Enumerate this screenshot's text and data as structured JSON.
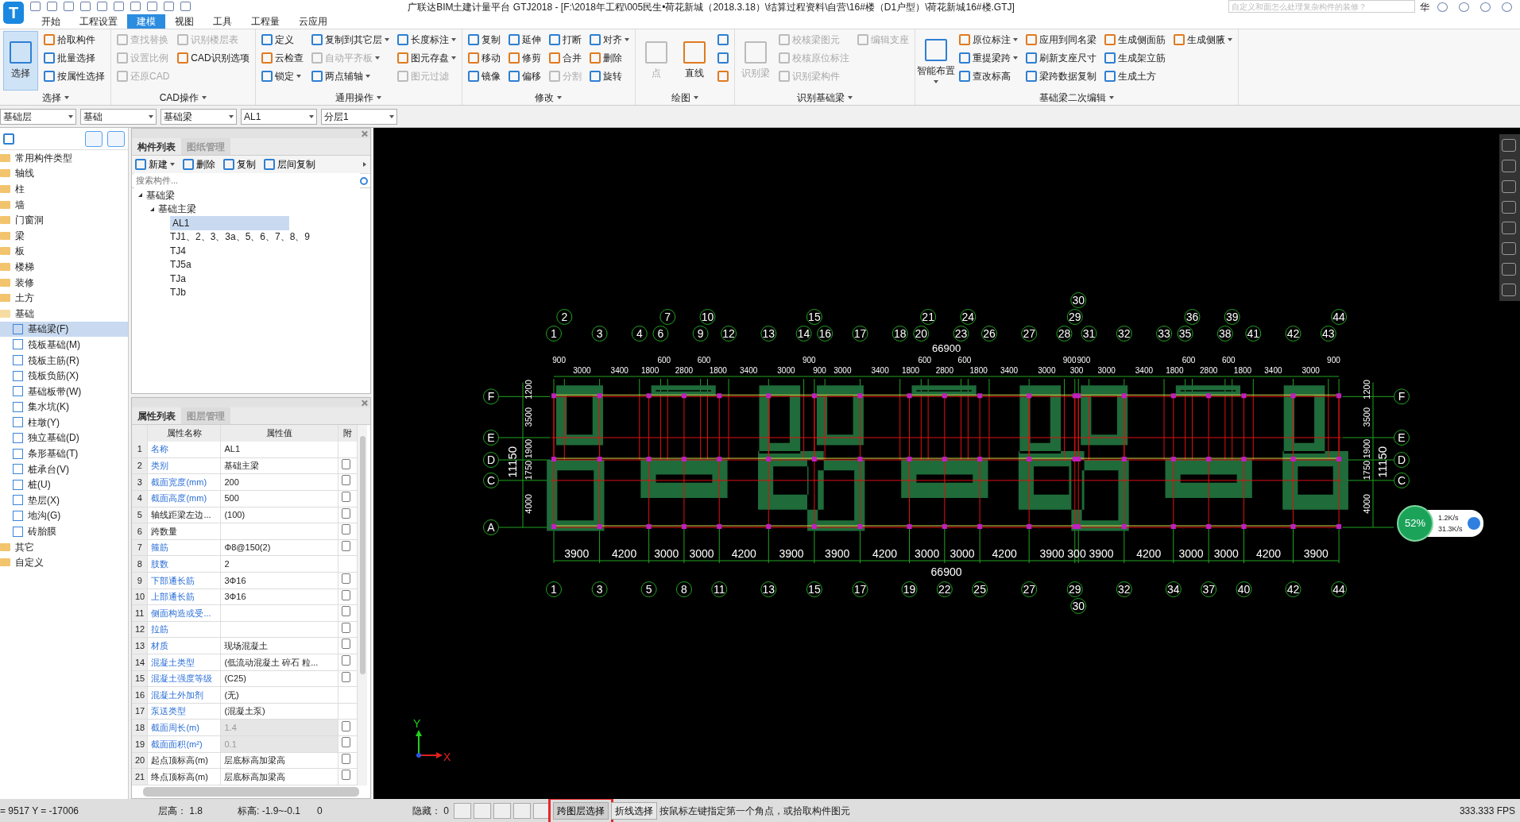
{
  "app": {
    "logo_text": "T",
    "title": "广联达BIM土建计量平台 GTJ2018 - [F:\\2018年工程\\005民生•荷花新城（2018.3.18）\\结算过程资料\\自营\\16#楼（D1户型）\\荷花新城16#楼.GTJ]",
    "search_placeholder": "自定义和面怎么处理复杂构件的装修？",
    "user": "华"
  },
  "tabs": [
    {
      "label": "开始",
      "selected": false
    },
    {
      "label": "工程设置",
      "selected": false
    },
    {
      "label": "建模",
      "selected": true
    },
    {
      "label": "视图",
      "selected": false
    },
    {
      "label": "工具",
      "selected": false
    },
    {
      "label": "工程量",
      "selected": false
    },
    {
      "label": "云应用",
      "selected": false
    }
  ],
  "ribbon": [
    {
      "label": "选择",
      "items": [
        {
          "label": "选择",
          "kind": "large",
          "selected": true,
          "disabled": false,
          "dropdown": false
        },
        {
          "label": "拾取构件",
          "kind": "small",
          "selected": false,
          "disabled": false,
          "dropdown": false
        },
        {
          "label": "批量选择",
          "kind": "small",
          "selected": false,
          "disabled": false,
          "dropdown": false
        },
        {
          "label": "按属性选择",
          "kind": "small",
          "selected": false,
          "disabled": false,
          "dropdown": false
        }
      ]
    },
    {
      "label": "CAD操作",
      "items": [
        {
          "label": "查找替换",
          "kind": "small",
          "selected": false,
          "disabled": true,
          "dropdown": false
        },
        {
          "label": "设置比例",
          "kind": "small",
          "selected": false,
          "disabled": true,
          "dropdown": false
        },
        {
          "label": "还原CAD",
          "kind": "small",
          "selected": false,
          "disabled": true,
          "dropdown": false
        },
        {
          "label": "识别楼层表",
          "kind": "small",
          "selected": false,
          "disabled": true,
          "dropdown": false
        },
        {
          "label": "CAD识别选项",
          "kind": "small",
          "selected": false,
          "disabled": false,
          "dropdown": false
        }
      ]
    },
    {
      "label": "通用操作",
      "items": [
        {
          "label": "定义",
          "kind": "small",
          "selected": false,
          "disabled": false,
          "dropdown": false
        },
        {
          "label": "云检查",
          "kind": "small",
          "selected": false,
          "disabled": false,
          "dropdown": false
        },
        {
          "label": "锁定",
          "kind": "small",
          "selected": false,
          "disabled": false,
          "dropdown": true
        },
        {
          "label": "复制到其它层",
          "kind": "small",
          "selected": false,
          "disabled": false,
          "dropdown": true
        },
        {
          "label": "自动平齐板",
          "kind": "small",
          "selected": false,
          "disabled": true,
          "dropdown": true
        },
        {
          "label": "两点辅轴",
          "kind": "small",
          "selected": false,
          "disabled": false,
          "dropdown": true
        },
        {
          "label": "长度标注",
          "kind": "small",
          "selected": false,
          "disabled": false,
          "dropdown": true
        },
        {
          "label": "图元存盘",
          "kind": "small",
          "selected": false,
          "disabled": false,
          "dropdown": true
        },
        {
          "label": "图元过滤",
          "kind": "small",
          "selected": false,
          "disabled": true,
          "dropdown": false
        }
      ]
    },
    {
      "label": "修改",
      "items": [
        {
          "label": "复制",
          "kind": "small",
          "selected": false,
          "disabled": false,
          "dropdown": false
        },
        {
          "label": "移动",
          "kind": "small",
          "selected": false,
          "disabled": false,
          "dropdown": false
        },
        {
          "label": "镜像",
          "kind": "small",
          "selected": false,
          "disabled": false,
          "dropdown": false
        },
        {
          "label": "延伸",
          "kind": "small",
          "selected": false,
          "disabled": false,
          "dropdown": false
        },
        {
          "label": "修剪",
          "kind": "small",
          "selected": false,
          "disabled": false,
          "dropdown": false
        },
        {
          "label": "偏移",
          "kind": "small",
          "selected": false,
          "disabled": false,
          "dropdown": false
        },
        {
          "label": "打断",
          "kind": "small",
          "selected": false,
          "disabled": false,
          "dropdown": false
        },
        {
          "label": "合并",
          "kind": "small",
          "selected": false,
          "disabled": false,
          "dropdown": false
        },
        {
          "label": "分割",
          "kind": "small",
          "selected": false,
          "disabled": true,
          "dropdown": false
        },
        {
          "label": "对齐",
          "kind": "small",
          "selected": false,
          "disabled": false,
          "dropdown": true
        },
        {
          "label": "删除",
          "kind": "small",
          "selected": false,
          "disabled": false,
          "dropdown": false
        },
        {
          "label": "旋转",
          "kind": "small",
          "selected": false,
          "disabled": false,
          "dropdown": false
        }
      ]
    },
    {
      "label": "绘图",
      "items": [
        {
          "label": "点",
          "kind": "large",
          "selected": false,
          "disabled": true,
          "dropdown": false
        },
        {
          "label": "直线",
          "kind": "large",
          "selected": false,
          "disabled": false,
          "dropdown": false
        },
        {
          "kind": "small",
          "selected": false,
          "disabled": false,
          "dropdown": false
        },
        {
          "kind": "small",
          "selected": false,
          "disabled": false,
          "dropdown": false
        },
        {
          "kind": "small",
          "selected": false,
          "disabled": false,
          "dropdown": false
        }
      ]
    },
    {
      "label": "识别基础梁",
      "items": [
        {
          "label": "识别梁",
          "kind": "large",
          "selected": false,
          "disabled": true,
          "dropdown": false
        },
        {
          "label": "校核梁图元",
          "kind": "small",
          "selected": false,
          "disabled": true,
          "dropdown": false
        },
        {
          "label": "校核原位标注",
          "kind": "small",
          "selected": false,
          "disabled": true,
          "dropdown": false
        },
        {
          "label": "识别梁构件",
          "kind": "small",
          "selected": false,
          "disabled": true,
          "dropdown": false
        },
        {
          "label": "编辑支座",
          "kind": "small",
          "selected": false,
          "disabled": true,
          "dropdown": false
        }
      ]
    },
    {
      "label": "基础梁二次编辑",
      "items": [
        {
          "label": "智能布置",
          "kind": "large",
          "selected": false,
          "disabled": false,
          "dropdown": true
        },
        {
          "label": "原位标注",
          "kind": "small",
          "selected": false,
          "disabled": false,
          "dropdown": true
        },
        {
          "label": "重提梁跨",
          "kind": "small",
          "selected": false,
          "disabled": false,
          "dropdown": true
        },
        {
          "label": "查改标高",
          "kind": "small",
          "selected": false,
          "disabled": false,
          "dropdown": false
        },
        {
          "label": "应用到同名梁",
          "kind": "small",
          "selected": false,
          "disabled": false,
          "dropdown": false
        },
        {
          "label": "刷新支座尺寸",
          "kind": "small",
          "selected": false,
          "disabled": false,
          "dropdown": false
        },
        {
          "label": "梁跨数据复制",
          "kind": "small",
          "selected": false,
          "disabled": false,
          "dropdown": false
        },
        {
          "label": "生成侧面筋",
          "kind": "small",
          "selected": false,
          "disabled": false,
          "dropdown": false
        },
        {
          "label": "生成架立筋",
          "kind": "small",
          "selected": false,
          "disabled": false,
          "dropdown": false
        },
        {
          "label": "生成土方",
          "kind": "small",
          "selected": false,
          "disabled": false,
          "dropdown": false
        },
        {
          "label": "生成侧腋",
          "kind": "small",
          "selected": false,
          "disabled": false,
          "dropdown": true
        }
      ]
    }
  ],
  "selectors": [
    "基础层",
    "基础",
    "基础梁",
    "AL1",
    "分层1"
  ],
  "nav_tree": [
    {
      "label": "常用构件类型",
      "expanded": false
    },
    {
      "label": "轴线",
      "expanded": false
    },
    {
      "label": "柱",
      "expanded": false
    },
    {
      "label": "墙",
      "expanded": false
    },
    {
      "label": "门窗洞",
      "expanded": false
    },
    {
      "label": "梁",
      "expanded": false
    },
    {
      "label": "板",
      "expanded": false
    },
    {
      "label": "楼梯",
      "expanded": false
    },
    {
      "label": "装修",
      "expanded": false
    },
    {
      "label": "土方",
      "expanded": false
    },
    {
      "label": "基础",
      "expanded": true,
      "children": [
        {
          "label": "基础梁(F)",
          "selected": true
        },
        {
          "label": "筏板基础(M)",
          "selected": false
        },
        {
          "label": "筏板主筋(R)",
          "selected": false
        },
        {
          "label": "筏板负筋(X)",
          "selected": false
        },
        {
          "label": "基础板带(W)",
          "selected": false
        },
        {
          "label": "集水坑(K)",
          "selected": false
        },
        {
          "label": "柱墩(Y)",
          "selected": false
        },
        {
          "label": "独立基础(D)",
          "selected": false
        },
        {
          "label": "条形基础(T)",
          "selected": false
        },
        {
          "label": "桩承台(V)",
          "selected": false
        },
        {
          "label": "桩(U)",
          "selected": false
        },
        {
          "label": "垫层(X)",
          "selected": false
        },
        {
          "label": "地沟(G)",
          "selected": false
        },
        {
          "label": "砖胎膜",
          "selected": false
        }
      ]
    },
    {
      "label": "其它",
      "expanded": false
    },
    {
      "label": "自定义",
      "expanded": false
    }
  ],
  "component_panel": {
    "tabs": [
      {
        "label": "构件列表",
        "selected": true
      },
      {
        "label": "图纸管理",
        "selected": false
      }
    ],
    "toolbar": [
      {
        "label": "新建",
        "dropdown": true
      },
      {
        "label": "删除",
        "dropdown": false
      },
      {
        "label": "复制",
        "dropdown": false
      },
      {
        "label": "层间复制",
        "dropdown": false
      }
    ],
    "search_placeholder": "搜索构件...",
    "tree": [
      {
        "label": "基础梁",
        "expanded": true,
        "selected": false,
        "children": [
          {
            "label": "基础主梁",
            "expanded": true,
            "selected": false,
            "children": [
              {
                "label": "AL1",
                "selected": true
              },
              {
                "label": "TJ1、2、3、3a、5、6、7、8、9",
                "selected": false
              },
              {
                "label": "TJ4",
                "selected": false
              },
              {
                "label": "TJ5a",
                "selected": false
              },
              {
                "label": "TJa",
                "selected": false
              },
              {
                "label": "TJb",
                "selected": false
              }
            ]
          }
        ]
      }
    ]
  },
  "property_panel": {
    "tabs": [
      {
        "label": "属性列表",
        "selected": true
      },
      {
        "label": "图层管理",
        "selected": false
      }
    ],
    "columns": [
      "属性名称",
      "属性值",
      "附"
    ],
    "rows": [
      {
        "index": "1",
        "name": "名称",
        "value": "AL1",
        "public": true,
        "kind": "plain",
        "readonly": false
      },
      {
        "index": "2",
        "name": "类别",
        "value": "基础主梁",
        "public": true,
        "kind": "check",
        "checked": false,
        "readonly": false
      },
      {
        "index": "3",
        "name": "截面宽度(mm)",
        "value": "200",
        "public": true,
        "kind": "check",
        "checked": false,
        "readonly": false
      },
      {
        "index": "4",
        "name": "截面高度(mm)",
        "value": "500",
        "public": true,
        "kind": "check",
        "checked": false,
        "readonly": false
      },
      {
        "index": "5",
        "name": "轴线距梁左边...",
        "value": "(100)",
        "public": false,
        "kind": "check",
        "checked": false,
        "readonly": false
      },
      {
        "index": "6",
        "name": "跨数量",
        "public": false,
        "kind": "check",
        "checked": false,
        "readonly": false
      },
      {
        "index": "7",
        "name": "箍筋",
        "value": "Φ8@150(2)",
        "public": true,
        "kind": "check",
        "checked": false,
        "readonly": false
      },
      {
        "index": "8",
        "name": "肢数",
        "value": "2",
        "public": true,
        "kind": "plain",
        "readonly": false
      },
      {
        "index": "9",
        "name": "下部通长筋",
        "value": "3Φ16",
        "public": true,
        "kind": "check",
        "checked": false,
        "readonly": false
      },
      {
        "index": "10",
        "name": "上部通长筋",
        "value": "3Φ16",
        "public": true,
        "kind": "check",
        "checked": false,
        "readonly": false
      },
      {
        "index": "11",
        "name": "侧面构造或受...",
        "public": true,
        "kind": "check",
        "checked": false,
        "readonly": false
      },
      {
        "index": "12",
        "name": "拉筋",
        "public": true,
        "kind": "check",
        "checked": false,
        "readonly": false
      },
      {
        "index": "13",
        "name": "材质",
        "value": "现场混凝土",
        "public": true,
        "kind": "check",
        "checked": false,
        "readonly": false
      },
      {
        "index": "14",
        "name": "混凝土类型",
        "value": "(低流动混凝土 碎石 粒...",
        "public": true,
        "kind": "check",
        "checked": false,
        "readonly": false
      },
      {
        "index": "15",
        "name": "混凝土强度等级",
        "value": "(C25)",
        "public": true,
        "kind": "check",
        "checked": false,
        "readonly": false
      },
      {
        "index": "16",
        "name": "混凝土外加剂",
        "value": "(无)",
        "public": true,
        "kind": "plain",
        "readonly": false
      },
      {
        "index": "17",
        "name": "泵送类型",
        "value": "(混凝土泵)",
        "public": true,
        "kind": "plain",
        "readonly": false
      },
      {
        "index": "18",
        "name": "截面周长(m)",
        "value": "1.4",
        "public": true,
        "kind": "check",
        "checked": false,
        "readonly": true
      },
      {
        "index": "19",
        "name": "截面面积(m²)",
        "value": "0.1",
        "public": true,
        "kind": "check",
        "checked": false,
        "readonly": true
      },
      {
        "index": "20",
        "name": "起点顶标高(m)",
        "value": "层底标高加梁高",
        "public": false,
        "kind": "check",
        "checked": false,
        "readonly": false
      },
      {
        "index": "21",
        "name": "终点顶标高(m)",
        "value": "层底标高加梁高",
        "public": false,
        "kind": "check",
        "checked": false,
        "readonly": false
      }
    ]
  },
  "plan": {
    "top_axes": [
      "1",
      "2",
      "3",
      "4",
      "6",
      "7",
      "9",
      "10",
      "12",
      "13",
      "14",
      "15",
      "16",
      "17",
      "18",
      "20",
      "21",
      "23",
      "24",
      "26",
      "27",
      "28",
      "29",
      "30",
      "31",
      "32",
      "33",
      "35",
      "36",
      "38",
      "39",
      "41",
      "42",
      "43",
      "44"
    ],
    "top_dims": [
      "900",
      "3000",
      "3400",
      "1800",
      "600",
      "2800",
      "600",
      "1800",
      "3400",
      "3000",
      "900",
      "900",
      "3000",
      "3400",
      "1800",
      "600",
      "2800",
      "600",
      "1800",
      "3400",
      "3000",
      "900",
      "300",
      "900",
      "3000",
      "3400",
      "1800",
      "600",
      "2800",
      "600",
      "1800",
      "3400",
      "3000",
      "900"
    ],
    "top_total": "66900",
    "bottom_axes": [
      "1",
      "3",
      "5",
      "8",
      "11",
      "13",
      "15",
      "17",
      "19",
      "22",
      "25",
      "27",
      "29",
      "30",
      "32",
      "34",
      "37",
      "40",
      "42",
      "44"
    ],
    "bottom_dims": [
      "3900",
      "4200",
      "3000",
      "3000",
      "4200",
      "3900",
      "3900",
      "4200",
      "3000",
      "3000",
      "4200",
      "3900",
      "300",
      "3900",
      "4200",
      "3000",
      "3000",
      "4200",
      "3900"
    ],
    "bottom_total": "66900",
    "rows_left": [
      "F",
      "E",
      "D",
      "C",
      "A"
    ],
    "left_dims": [
      "1200",
      "3500",
      "1900",
      "1750",
      "4000"
    ],
    "left_total": "11150",
    "rows_right": [
      "F",
      "E",
      "D",
      "C"
    ],
    "right_dims": [
      "1200",
      "3500",
      "1900",
      "1750",
      "4000"
    ],
    "right_total": "11150",
    "axis_y": "Y",
    "axis_x": "X"
  },
  "network": {
    "percent": "52%",
    "up": "1.2K/s",
    "down": "31.3K/s"
  },
  "status_bar": {
    "coords": "= 9517 Y = -17006",
    "floor_height": "层高： 1.8",
    "elevation": "标高: -1.9~-0.1",
    "value": "0",
    "hidden": "隐藏： 0",
    "buttons": [
      {
        "label": "跨图层选择",
        "selected": true,
        "outlined": true
      },
      {
        "label": "折线选择",
        "selected": false,
        "outlined": false
      }
    ],
    "hint": "按鼠标左键指定第一个角点，或拾取构件图元",
    "fps": "333.333 FPS"
  }
}
